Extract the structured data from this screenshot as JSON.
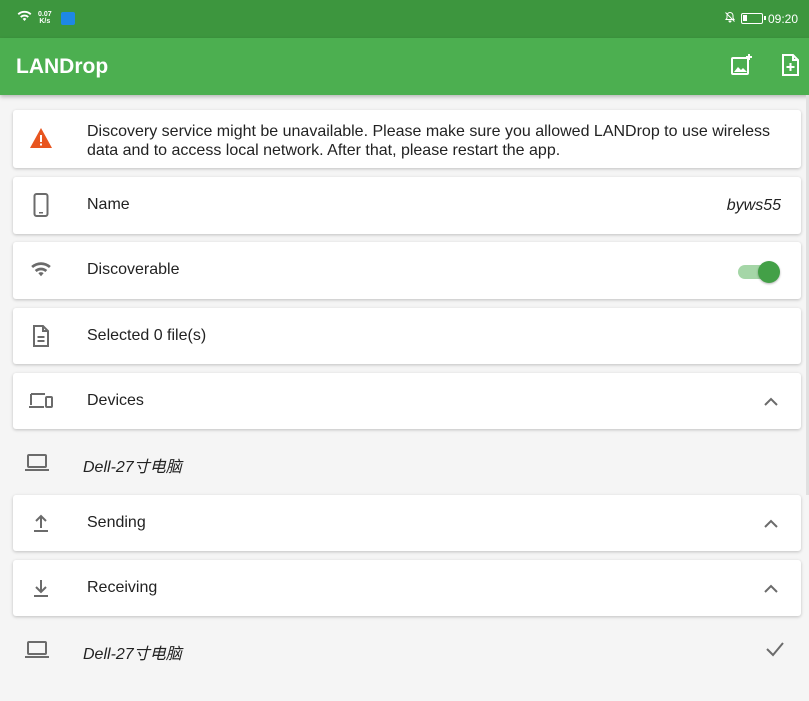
{
  "status_bar": {
    "net_speed_value": "0.07",
    "net_speed_unit": "K/s",
    "time": "09:20",
    "icons": [
      "wifi-icon",
      "app-notification-icon",
      "silent-icon",
      "battery-icon"
    ]
  },
  "app_bar": {
    "title": "LANDrop",
    "actions": [
      "add-image-icon",
      "add-file-icon"
    ],
    "color": "#4caf50"
  },
  "warning": {
    "icon": "warning-icon",
    "text": "Discovery service might be unavailable. Please make sure you allowed LANDrop to use wireless data and to access local network. After that, please restart the app."
  },
  "settings": {
    "name_label": "Name",
    "name_value": "byws55",
    "discoverable_label": "Discoverable",
    "discoverable_enabled": true,
    "selected_files_label": "Selected 0 file(s)"
  },
  "sections": {
    "devices": {
      "label": "Devices",
      "items": [
        {
          "name": "Dell-27寸电脑"
        }
      ]
    },
    "sending": {
      "label": "Sending",
      "items": []
    },
    "receiving": {
      "label": "Receiving",
      "items": [
        {
          "name": "Dell-27寸电脑",
          "done": true
        }
      ]
    }
  },
  "colors": {
    "accent": "#43a047",
    "status_bar": "#3d963e",
    "warning": "#e8551f",
    "icon_gray": "#6b6b6b"
  }
}
